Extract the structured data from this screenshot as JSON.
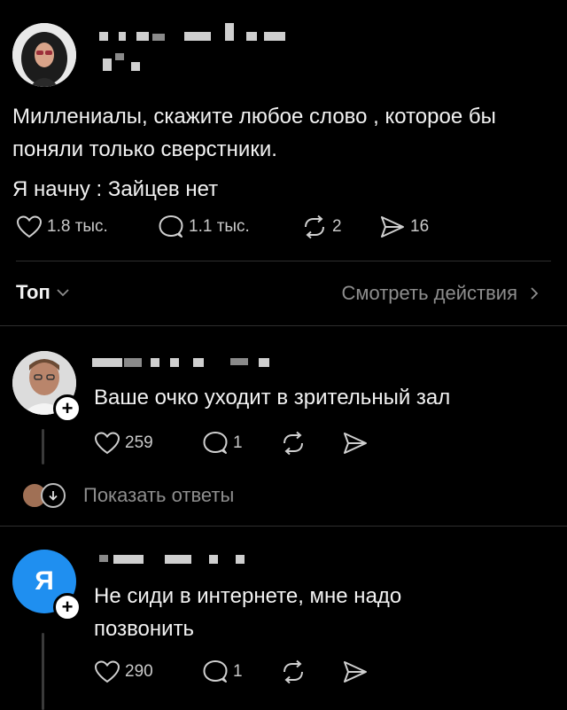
{
  "post": {
    "text_lines": [
      "Миллениалы, скажите любое слово , которое бы",
      "поняли только сверстники."
    ],
    "text_second": "Я начну : Зайцев нет",
    "likes": "1.8 тыс.",
    "replies": "1.1 тыс.",
    "reposts": "2",
    "shares": "16"
  },
  "sort": {
    "label": "Топ",
    "activity_link": "Смотреть действия"
  },
  "comments": [
    {
      "text": "Ваше очко уходит в зрительный зал",
      "likes": "259",
      "replies": "1",
      "show_replies": "Показать ответы"
    },
    {
      "avatar_letter": "Я",
      "text_lines": [
        "Не сиди в интернете, мне надо",
        "позвонить"
      ],
      "likes": "290",
      "replies": "1"
    }
  ],
  "colors": {
    "background": "#000000",
    "text": "#f2f2f2",
    "muted": "#8e8e8e",
    "comment2_avatar": "#1f8ff0"
  }
}
